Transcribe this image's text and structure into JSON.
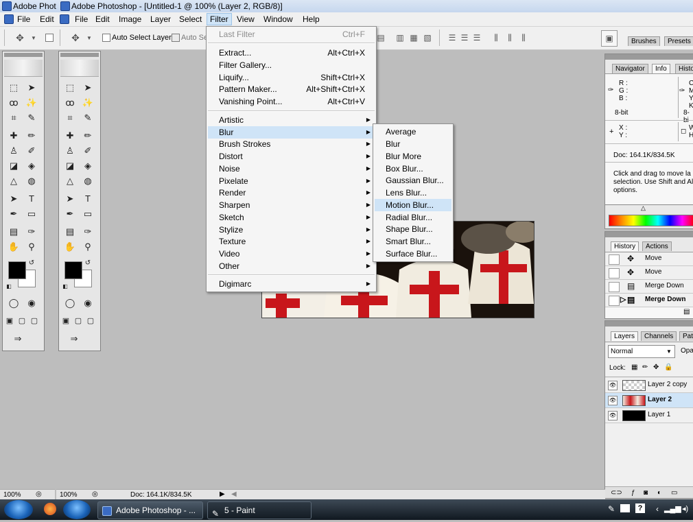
{
  "titlebar": {
    "app_short": "Adobe Phot",
    "title": "Adobe Photoshop - [Untitled-1 @ 100% (Layer 2, RGB/8)]"
  },
  "menubar": {
    "items": [
      "File",
      "Edit",
      "File",
      "Edit",
      "Image",
      "Layer",
      "Select",
      "Filter",
      "View",
      "Window",
      "Help"
    ]
  },
  "options": {
    "auto_select_layer": "Auto Select Layer",
    "auto_select_short": "Auto Se",
    "palette_tabs": [
      "Brushes",
      "Presets"
    ]
  },
  "filter_menu": {
    "last_filter": "Last Filter",
    "last_filter_shortcut": "Ctrl+F",
    "extract": "Extract...",
    "extract_shortcut": "Alt+Ctrl+X",
    "filter_gallery": "Filter Gallery...",
    "liquify": "Liquify...",
    "liquify_shortcut": "Shift+Ctrl+X",
    "pattern_maker": "Pattern Maker...",
    "pattern_maker_shortcut": "Alt+Shift+Ctrl+X",
    "vanishing_point": "Vanishing Point...",
    "vanishing_point_shortcut": "Alt+Ctrl+V",
    "categories": [
      "Artistic",
      "Blur",
      "Brush Strokes",
      "Distort",
      "Noise",
      "Pixelate",
      "Render",
      "Sharpen",
      "Sketch",
      "Stylize",
      "Texture",
      "Video",
      "Other"
    ],
    "digimarc": "Digimarc"
  },
  "blur_submenu": {
    "items": [
      "Average",
      "Blur",
      "Blur More",
      "Box Blur...",
      "Gaussian Blur...",
      "Lens Blur...",
      "Motion Blur...",
      "Radial Blur...",
      "Shape Blur...",
      "Smart Blur...",
      "Surface Blur..."
    ]
  },
  "info_panel": {
    "tabs": [
      "Navigator",
      "Info",
      "Histo"
    ],
    "r": "R :",
    "g": "G :",
    "b": "B :",
    "bit": "8-bit",
    "bit2": "8-bi",
    "x": "X :",
    "y": "Y :",
    "c": "C",
    "m": "M",
    "y2": "Y",
    "k": "K",
    "w": "W",
    "h": "H",
    "doc": "Doc: 164.1K/834.5K",
    "hint": "Click and drag to move la selection. Use Shift and Al options."
  },
  "history_panel": {
    "tabs": [
      "History",
      "Actions"
    ],
    "items": [
      "Move",
      "Move",
      "Merge Down",
      "Merge Down"
    ]
  },
  "layers_panel": {
    "tabs": [
      "Layers",
      "Channels",
      "Path"
    ],
    "blend_mode": "Normal",
    "opacity_label": "Opa",
    "lock_label": "Lock:",
    "layers": [
      "Layer 2 copy",
      "Layer 2",
      "Layer 1"
    ]
  },
  "status": {
    "zoom1": "100%",
    "zoom2": "100%",
    "doc": "Doc: 164.1K/834.5K"
  },
  "taskbar": {
    "items": [
      "Adobe Photoshop - ...",
      "5 - Paint"
    ]
  },
  "colors": {
    "menu_highlight": "#cfe4f7",
    "workspace": "#bdbdbd",
    "taskbar": "#1b242e"
  }
}
